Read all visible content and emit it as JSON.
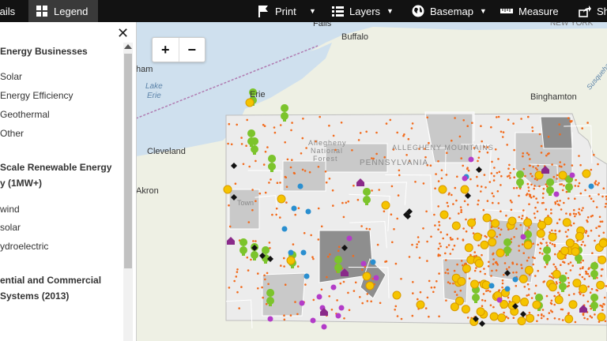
{
  "toolbar": {
    "details_label": "tails",
    "legend_label": "Legend",
    "print_label": "Print",
    "layers_label": "Layers",
    "basemap_label": "Basemap",
    "measure_label": "Measure",
    "share_label": "Sha"
  },
  "legend": {
    "close_icon": "✕",
    "section1_title": "Energy Businesses",
    "section1_items": [
      "Solar",
      "Energy Efficiency",
      "Geothermal",
      "Other"
    ],
    "section2_title_1": "Scale Renewable Energy",
    "section2_title_2": "y (1MW+)",
    "section2_items": [
      "wind",
      "solar",
      "ydroelectric"
    ],
    "section3_title_1": "ential and Commercial",
    "section3_title_2": "Systems (2013)"
  },
  "map": {
    "zoom_in": "+",
    "zoom_out": "−",
    "labels": {
      "falls": "Falls",
      "buffalo": "Buffalo",
      "new_york": "NEW YORK",
      "lake_erie_1": "Lake",
      "lake_erie_2": "Erie",
      "erie": "Erie",
      "binghamton": "Binghamton",
      "cleveland": "Cleveland",
      "akron": "Akron",
      "allegheny_forest_1": "Allegheny",
      "allegheny_forest_2": "National",
      "allegheny_forest_3": "Forest",
      "allegheny_mountains": "ALLEGHENY MOUNTAINS",
      "pennsylvania": "PENNSYLVANIA",
      "susquehanna": "Susquehanna",
      "ham": "ham",
      "town": "Town"
    },
    "colors": {
      "water": "#cfe0ee",
      "land": "#eef0e4",
      "county_light": "#ececec",
      "county_mid": "#c9c9c9",
      "county_dark": "#8e8e8e",
      "dot_orange": "#f26b1d",
      "dot_blue": "#2a8fd0",
      "dot_purple": "#b33cc8",
      "sun_yellow": "#f5c400",
      "bulb_green": "#7cc42c",
      "diamond_black": "#111111",
      "house_purple": "#8a2a8a"
    }
  }
}
